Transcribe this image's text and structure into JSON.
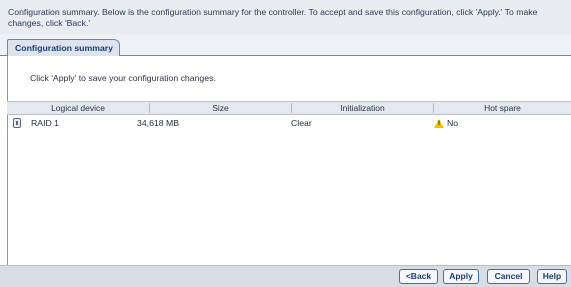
{
  "header": {
    "text": "Configuration summary. Below is the configuration summary for the controller. To accept and save this configuration, click 'Apply.' To make changes, click 'Back.'"
  },
  "tabs": [
    {
      "label": "Configuration summary"
    }
  ],
  "hint": "Click 'Apply' to save your configuration changes.",
  "table": {
    "columns": [
      "Logical device",
      "Size",
      "Initialization",
      "Hot spare"
    ],
    "rows": [
      {
        "device": "RAID 1",
        "device_icon": "disk-icon",
        "size": "34,618 MB",
        "initialization": "Clear",
        "hot_spare": "No",
        "hot_spare_icon": "warning-icon"
      }
    ]
  },
  "buttons": {
    "back": "<Back",
    "apply": "Apply",
    "cancel": "Cancel",
    "help": "Help"
  },
  "colors": {
    "accent": "#1d3d75",
    "warning": "#f2c200"
  }
}
